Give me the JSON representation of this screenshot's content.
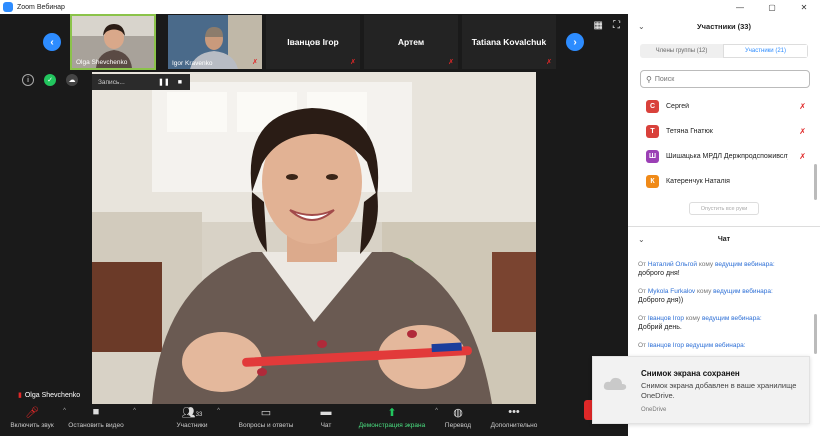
{
  "window": {
    "title": "Zoom Вебинар",
    "controls": [
      "—",
      "▢",
      "✕"
    ]
  },
  "strip": {
    "thumbs": [
      {
        "name": "Olga Shevchenko",
        "label": "",
        "active": true
      },
      {
        "name": "Igor Kravenko",
        "label": "",
        "active": false
      },
      {
        "name": "",
        "label": "Іванцов Ігор",
        "active": false
      },
      {
        "name": "",
        "label": "Артем",
        "active": false
      },
      {
        "name": "",
        "label": "Tatiana Kovalchuk",
        "active": false
      }
    ]
  },
  "recording": {
    "label": "Запись...",
    "pause": "❚❚",
    "stop": "■"
  },
  "speaker": {
    "name": "Olga Shevchenko"
  },
  "toolbar": {
    "items": [
      {
        "icon": "microphone-muted-icon",
        "label": "Включить звук"
      },
      {
        "icon": "video-camera-icon",
        "label": "Остановить видео"
      },
      {
        "icon": "participants-icon",
        "label": "Участники",
        "count": "33"
      },
      {
        "icon": "qa-icon",
        "label": "Вопросы и ответы"
      },
      {
        "icon": "chat-icon",
        "label": "Чат"
      },
      {
        "icon": "share-screen-icon",
        "label": "Демонстрация экрана"
      },
      {
        "icon": "globe-icon",
        "label": "Перевод"
      },
      {
        "icon": "more-icon",
        "label": "Дополнительно"
      }
    ]
  },
  "panel": {
    "participants_title": "Участники (33)",
    "tabs": [
      "Члены группы (12)",
      "Участники (21)"
    ],
    "active_tab": 1,
    "search_placeholder": "Поиск",
    "participants": [
      {
        "initial": "С",
        "name": "Сергей",
        "color": "#d9413b"
      },
      {
        "initial": "Т",
        "name": "Тетяна Гнатюк",
        "color": "#d9413b"
      },
      {
        "initial": "Ш",
        "name": "Шишацька МРДЛ Держпродспоживслужби",
        "color": "#9b3fb5"
      },
      {
        "initial": "К",
        "name": "Катеренчук Наталія",
        "color": "#f08a18"
      }
    ],
    "lower_all_hands": "Опустить все руки",
    "chat_title": "Чат",
    "messages": [
      {
        "from_prefix": "От",
        "from": "Наталий Ольгой",
        "to_prefix": "кому",
        "to": "ведущим вебинара:",
        "text": "доброго дня!"
      },
      {
        "from_prefix": "От",
        "from": "Mykola Furkalov",
        "to_prefix": "кому",
        "to": "ведущим вебинара:",
        "text": "Доброго дня))"
      },
      {
        "from_prefix": "От",
        "from": "Іванцов Ігор",
        "to_prefix": "кому",
        "to": "ведущим вебинара:",
        "text": "Добрий день."
      },
      {
        "from_prefix": "От",
        "from": "Іванцов Ігор",
        "to_prefix": "",
        "to": "ведущим вебинара:",
        "text": ""
      }
    ]
  },
  "toast": {
    "title": "Снимок экрана сохранен",
    "body": "Снимок экрана добавлен в ваше хранилище OneDrive.",
    "source": "OneDrive"
  },
  "colors": {
    "accent": "#2d8cff",
    "danger": "#e02828",
    "share": "#22c55e"
  }
}
